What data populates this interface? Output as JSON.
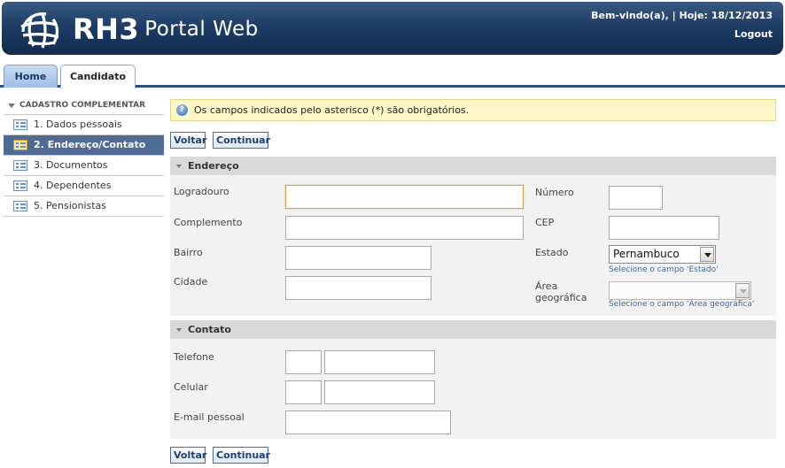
{
  "header": {
    "brand": "RH3",
    "product": "Portal Web",
    "welcome": "Bem-vindo(a), | Hoje: 18/12/2013",
    "logout": "Logout"
  },
  "tabs": [
    {
      "label": "Home",
      "active": false
    },
    {
      "label": "Candidato",
      "active": true
    }
  ],
  "sidebar": {
    "title": "CADASTRO COMPLEMENTAR",
    "items": [
      {
        "label": "1. Dados pessoais",
        "active": false
      },
      {
        "label": "2. Endereço/Contato",
        "active": true
      },
      {
        "label": "3. Documentos",
        "active": false
      },
      {
        "label": "4. Dependentes",
        "active": false
      },
      {
        "label": "5. Pensionistas",
        "active": false
      }
    ]
  },
  "info": {
    "text": "Os campos indicados pelo asterisco (*) são obrigatórios.",
    "icon": "help-icon"
  },
  "buttons": {
    "back": "Voltar",
    "continue": "Continuar"
  },
  "endereco": {
    "title": "Endereço",
    "logradouro": {
      "label": "Logradouro",
      "value": ""
    },
    "numero": {
      "label": "Número",
      "value": ""
    },
    "complemento": {
      "label": "Complemento",
      "value": ""
    },
    "cep": {
      "label": "CEP",
      "value": ""
    },
    "bairro": {
      "label": "Bairro",
      "value": ""
    },
    "estado": {
      "label": "Estado",
      "value": "Pernambuco",
      "hint": "Selecione o campo 'Estado'"
    },
    "cidade": {
      "label": "Cidade",
      "value": ""
    },
    "area": {
      "label_line1": "Área",
      "label_line2": "geográfica",
      "value": "",
      "hint": "Selecione o campo 'Área geográfica'"
    }
  },
  "contato": {
    "title": "Contato",
    "telefone": {
      "label": "Telefone",
      "ddd": "",
      "number": ""
    },
    "celular": {
      "label": "Celular",
      "ddd": "",
      "number": ""
    },
    "email": {
      "label": "E-mail pessoal",
      "value": ""
    }
  },
  "colors": {
    "header_dark": "#122a4d",
    "header_light": "#3a5a84",
    "sidebar_active": "#4e6a95",
    "info_bg": "#fdf6c6",
    "section_head": "#d9d9d9",
    "section_body": "#f2f2f2",
    "button_text": "#1d3f74"
  }
}
